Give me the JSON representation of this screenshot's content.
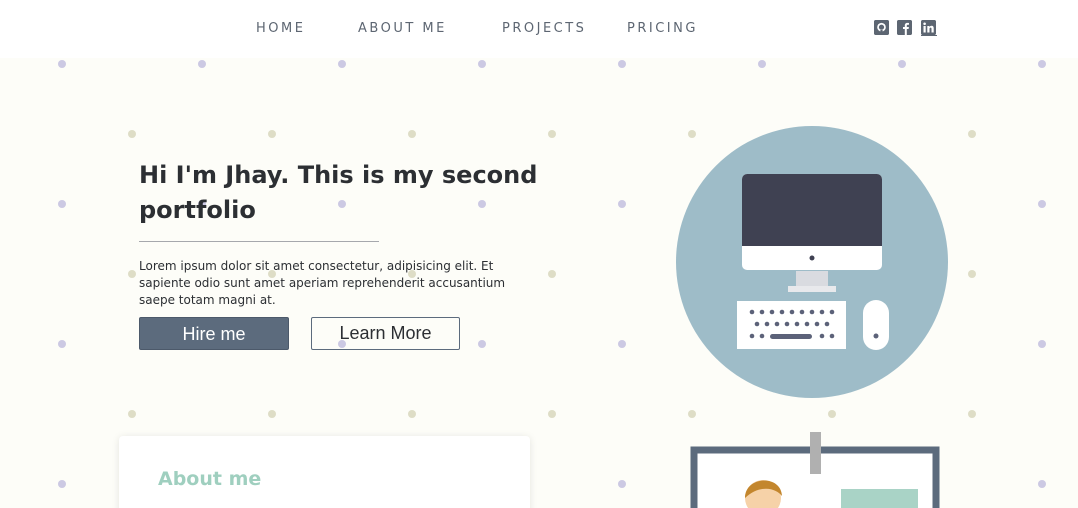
{
  "nav": {
    "items": [
      {
        "label": "HOME"
      },
      {
        "label": "ABOUT ME"
      },
      {
        "label": "PROJECTS"
      },
      {
        "label": "PRICING"
      }
    ],
    "social": [
      {
        "icon": "github-icon"
      },
      {
        "icon": "facebook-icon"
      },
      {
        "icon": "linkedin-icon"
      }
    ]
  },
  "hero": {
    "title": "Hi I'm Jhay. This is my second portfolio",
    "text": "Lorem ipsum dolor sit amet consectetur, adipisicing elit. Et sapiente odio sunt amet aperiam reprehenderit accusantium saepe totam magni at.",
    "hire_label": "Hire me",
    "learn_label": "Learn More"
  },
  "about": {
    "title": "About me"
  },
  "colors": {
    "background": "#fdfdf8",
    "nav_text": "#5d6672",
    "button": "#5c6b7d",
    "accent": "#9fcfbf",
    "circle": "#9ebcc8",
    "monitor": "#3f4152"
  }
}
